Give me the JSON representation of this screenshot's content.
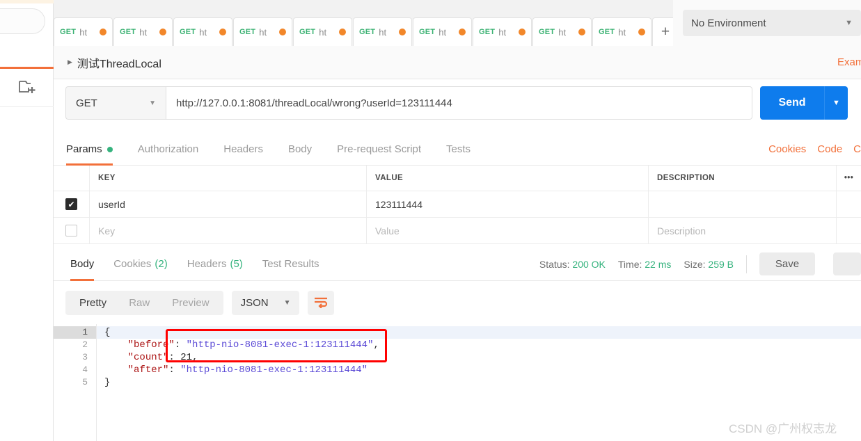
{
  "sidebar": {
    "search_placeholder": "",
    "new_collection_icon": "new-collection-icon"
  },
  "tabs": {
    "items": [
      {
        "method": "GET",
        "title": "ht",
        "unsaved": true
      },
      {
        "method": "GET",
        "title": "ht",
        "unsaved": true
      },
      {
        "method": "GET",
        "title": "ht",
        "unsaved": true
      },
      {
        "method": "GET",
        "title": "ht",
        "unsaved": true
      },
      {
        "method": "GET",
        "title": "ht",
        "unsaved": true
      },
      {
        "method": "GET",
        "title": "ht",
        "unsaved": true
      },
      {
        "method": "GET",
        "title": "ht",
        "unsaved": true
      },
      {
        "method": "GET",
        "title": "ht",
        "unsaved": true
      },
      {
        "method": "GET",
        "title": "ht",
        "unsaved": true
      },
      {
        "method": "GET",
        "title": "ht",
        "unsaved": true
      }
    ],
    "new_tab_label": "+",
    "more_label": "•••"
  },
  "environment": {
    "selected": "No Environment",
    "caret": "▼"
  },
  "breadcrumb": {
    "caret": "▶",
    "title": "测试ThreadLocal",
    "right_link": "Exam"
  },
  "request": {
    "method": "GET",
    "method_caret": "▼",
    "url": "http://127.0.0.1:8081/threadLocal/wrong?userId=123111444",
    "send_label": "Send",
    "send_caret": "▼"
  },
  "request_tabs": {
    "items": [
      {
        "label": "Params",
        "active": true,
        "dot": true
      },
      {
        "label": "Authorization",
        "active": false,
        "dot": false
      },
      {
        "label": "Headers",
        "active": false,
        "dot": false
      },
      {
        "label": "Body",
        "active": false,
        "dot": false
      },
      {
        "label": "Pre-request Script",
        "active": false,
        "dot": false
      },
      {
        "label": "Tests",
        "active": false,
        "dot": false
      }
    ],
    "right_links": [
      "Cookies",
      "Code",
      "C"
    ]
  },
  "params_table": {
    "headers": {
      "key": "KEY",
      "value": "VALUE",
      "description": "DESCRIPTION",
      "more": "•••"
    },
    "rows": [
      {
        "checked": true,
        "key": "userId",
        "value": "123111444",
        "description": ""
      }
    ],
    "placeholder_row": {
      "key": "Key",
      "value": "Value",
      "description": "Description"
    }
  },
  "response_tabs": {
    "items": [
      {
        "label": "Body",
        "count": "",
        "active": true
      },
      {
        "label": "Cookies",
        "count": "(2)",
        "active": false
      },
      {
        "label": "Headers",
        "count": "(5)",
        "active": false
      },
      {
        "label": "Test Results",
        "count": "",
        "active": false
      }
    ],
    "status_label": "Status:",
    "status_value": "200 OK",
    "time_label": "Time:",
    "time_value": "22 ms",
    "size_label": "Size:",
    "size_value": "259 B",
    "save_label": "Save"
  },
  "body_toolbar": {
    "views": [
      {
        "label": "Pretty",
        "active": true
      },
      {
        "label": "Raw",
        "active": false
      },
      {
        "label": "Preview",
        "active": false
      }
    ],
    "format": "JSON",
    "format_caret": "▼",
    "wrap_icon": "word-wrap-icon"
  },
  "response_body": {
    "line_numbers": [
      "1",
      "2",
      "3",
      "4",
      "5"
    ],
    "fold_caret": "▼",
    "lines": [
      {
        "text": "{",
        "highlight": true
      },
      {
        "key": "\"before\"",
        "sep": ": ",
        "value": "\"http-nio-8081-exec-1:123111444\"",
        "trail": ","
      },
      {
        "key": "\"count\"",
        "sep": ": ",
        "value": "21",
        "trail": ",",
        "numeric": true
      },
      {
        "key": "\"after\"",
        "sep": ": ",
        "value": "\"http-nio-8081-exec-1:123111444\"",
        "trail": ""
      },
      {
        "text": "}",
        "highlight": false
      }
    ],
    "json": {
      "before": "http-nio-8081-exec-1:123111444",
      "count": 21,
      "after": "http-nio-8081-exec-1:123111444"
    }
  },
  "annotation": {
    "type": "red-rectangle-highlight",
    "color": "#ff0000"
  },
  "watermark": {
    "text": "CSDN @广州权志龙"
  },
  "colors": {
    "accent_orange": "#f2703a",
    "send_blue": "#0e7ced",
    "success_green": "#36b37e",
    "method_green": "#3bb273",
    "unsaved_dot": "#f2872a"
  }
}
